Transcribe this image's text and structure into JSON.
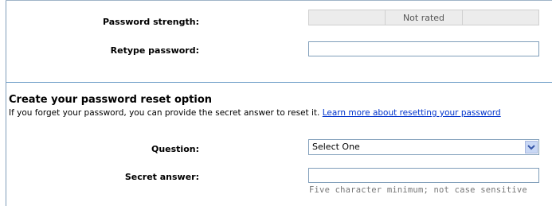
{
  "password_strength": {
    "label": "Password strength:",
    "value": "Not rated"
  },
  "retype_password": {
    "label": "Retype password:",
    "value": ""
  },
  "reset_section": {
    "title": "Create your password reset option",
    "description": "If you forget your password, you can provide the secret answer to reset it.",
    "link_text": "Learn more about resetting your password"
  },
  "question": {
    "label": "Question:",
    "selected": "Select One",
    "arrow_icon": "chevron-down-icon"
  },
  "secret_answer": {
    "label": "Secret answer:",
    "value": "",
    "hint": "Five character minimum; not case sensitive"
  },
  "colors": {
    "divider": "#6b9cc6",
    "link": "#0033cc",
    "input_border": "#7f9db9"
  }
}
